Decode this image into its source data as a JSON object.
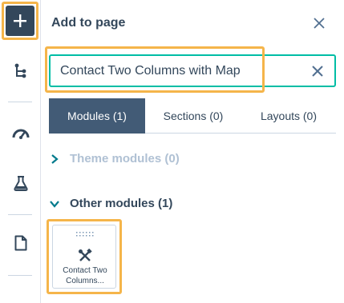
{
  "rail": {
    "add_label": "+",
    "icons": [
      "add-icon",
      "tree-structure-icon",
      "gauge-icon",
      "flask-icon",
      "page-icon"
    ]
  },
  "panel": {
    "title": "Add to page",
    "close_icon": "close-icon"
  },
  "search": {
    "value": "Contact Two Columns with Map",
    "clear_icon": "clear-icon"
  },
  "tabs": [
    {
      "label": "Modules (1)",
      "active": true
    },
    {
      "label": "Sections (0)",
      "active": false
    },
    {
      "label": "Layouts (0)",
      "active": false
    }
  ],
  "sections": {
    "theme": {
      "label": "Theme modules (0)",
      "expanded": false
    },
    "other": {
      "label": "Other modules (1)",
      "expanded": true
    }
  },
  "modules": [
    {
      "name_line1": "Contact Two",
      "name_line2": "Columns...",
      "icon": "tools-icon"
    }
  ],
  "colors": {
    "highlight": "#f5b54a",
    "dark": "#33475b",
    "active_tab": "#425b76",
    "focus": "#00bda5",
    "disabled": "#b0c1d4"
  }
}
